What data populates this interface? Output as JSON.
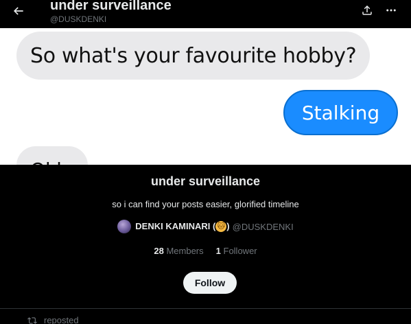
{
  "header": {
    "title": "under surveillance",
    "handle": "@DUSKDENKI",
    "back_icon": "arrow-left-icon",
    "share_icon": "share-icon",
    "more_icon": "more-icon"
  },
  "banner": {
    "bubble_incoming": "So what's your favourite hobby?",
    "bubble_outgoing": "Stalking",
    "bubble_partial": "Okk"
  },
  "list": {
    "name": "under surveillance",
    "description": "so i can find your posts easier, glorified timeline",
    "owner_name": "DENKI KAMINARI (",
    "owner_emoji": "🐱",
    "owner_name_close": ")",
    "owner_handle": "@DUSKDENKI",
    "members_count": "28",
    "members_label": "Members",
    "followers_count": "1",
    "followers_label": "Follower",
    "follow_label": "Follow"
  },
  "feed": {
    "repost_label": "reposted",
    "repost_icon": "repost-icon"
  },
  "colors": {
    "background": "#000000",
    "text": "#e7e9ea",
    "muted": "#71767b",
    "bubble_blue": "#1a8cff",
    "bubble_gray": "#e9e9eb"
  }
}
